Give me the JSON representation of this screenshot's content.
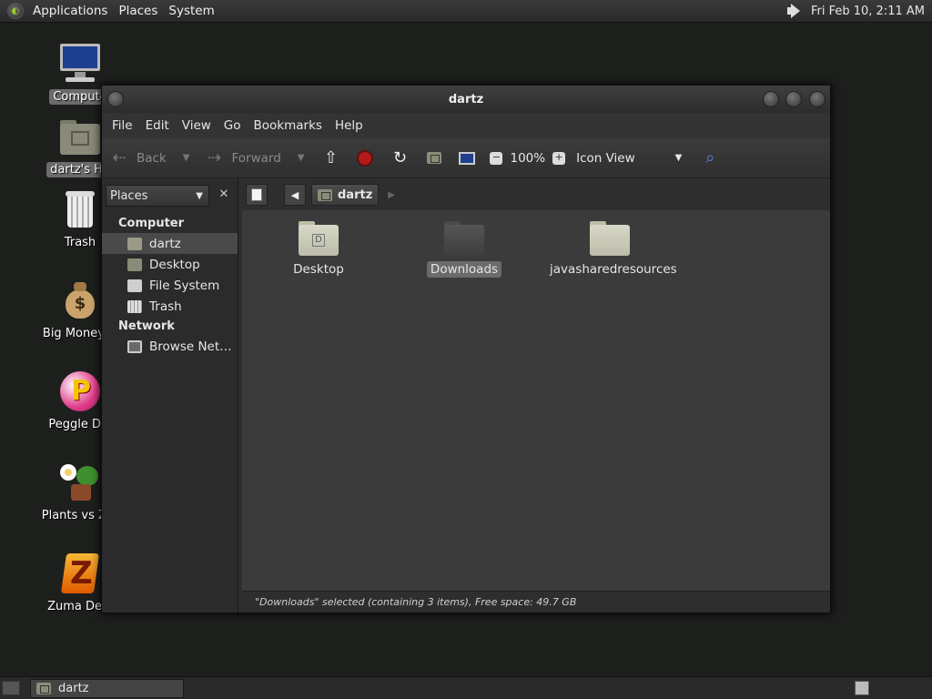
{
  "top_panel": {
    "menus": [
      "Applications",
      "Places",
      "System"
    ],
    "clock": "Fri Feb 10,  2:11 AM"
  },
  "desktop_icons": [
    {
      "label": "Compute",
      "icon": "computer-icon",
      "selected": true
    },
    {
      "label": "dartz's Ho",
      "icon": "home-folder-icon",
      "selected": true
    },
    {
      "label": "Trash",
      "icon": "trash-icon",
      "selected": false
    },
    {
      "label": "Big Money D",
      "icon": "money-bag-icon",
      "selected": false
    },
    {
      "label": "Peggle Del",
      "icon": "peggle-icon",
      "selected": false
    },
    {
      "label": "Plants vs Zor",
      "icon": "plants-icon",
      "selected": false
    },
    {
      "label": "Zuma Delu",
      "icon": "zuma-icon",
      "selected": false
    }
  ],
  "window": {
    "title": "dartz",
    "menus": [
      "File",
      "Edit",
      "View",
      "Go",
      "Bookmarks",
      "Help"
    ],
    "toolbar": {
      "back_label": "Back",
      "forward_label": "Forward",
      "zoom_level": "100%",
      "view_mode": "Icon View"
    },
    "sidepane": {
      "selector_label": "Places",
      "close_label": "✕",
      "sections": [
        {
          "header": "Computer",
          "items": [
            {
              "label": "dartz",
              "icon": "home-icon",
              "selected": true
            },
            {
              "label": "Desktop",
              "icon": "desktop-icon",
              "selected": false
            },
            {
              "label": "File System",
              "icon": "drive-icon",
              "selected": false
            },
            {
              "label": "Trash",
              "icon": "trash-icon",
              "selected": false
            }
          ]
        },
        {
          "header": "Network",
          "items": [
            {
              "label": "Browse Net…",
              "icon": "network-icon",
              "selected": false
            }
          ]
        }
      ]
    },
    "location": {
      "breadcrumb": "dartz"
    },
    "files": [
      {
        "label": "Desktop",
        "icon": "desktop-folder-icon",
        "selected": false
      },
      {
        "label": "Downloads",
        "icon": "folder-icon",
        "selected": true
      },
      {
        "label": "javasharedresources",
        "icon": "folder-icon",
        "selected": false
      }
    ],
    "status": "\"Downloads\" selected (containing 3 items), Free space: 49.7 GB"
  },
  "bottom_panel": {
    "task_label": "dartz"
  },
  "colors": {
    "desktop_bg": "#1d1f1d",
    "content_bg": "#3b3b3b",
    "selection": "#6b6b6b"
  }
}
